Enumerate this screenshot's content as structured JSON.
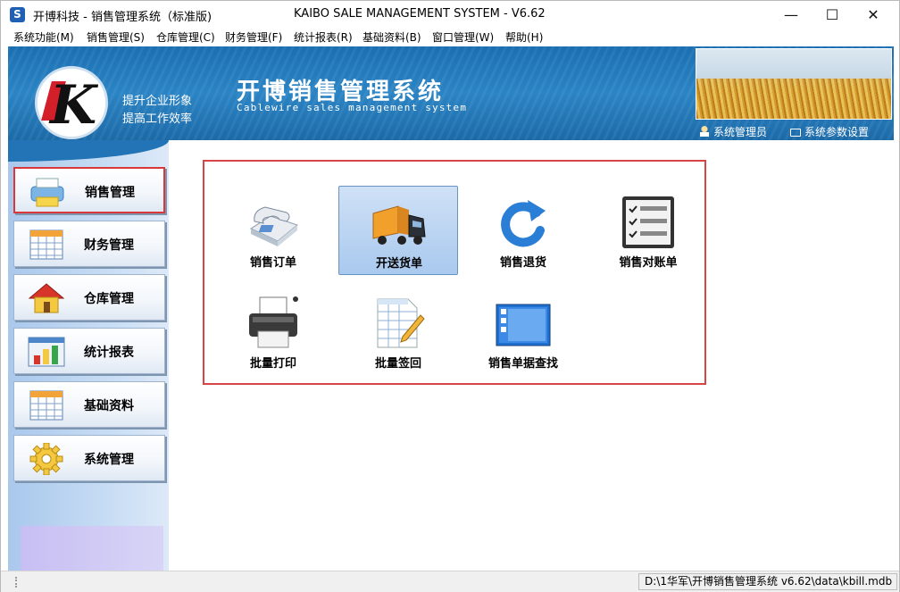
{
  "titlebar": {
    "title_left": "开博科技 - 销售管理系统（标准版)",
    "title_center": "KAIBO SALE MANAGEMENT SYSTEM - V6.62",
    "minimize": "—",
    "maximize": "☐",
    "close": "✕"
  },
  "menu": {
    "items": [
      {
        "label": "系统功能(M)"
      },
      {
        "label": "销售管理(S)"
      },
      {
        "label": "仓库管理(C)"
      },
      {
        "label": "财务管理(F)"
      },
      {
        "label": "统计报表(R)"
      },
      {
        "label": "基础资料(B)"
      },
      {
        "label": "窗口管理(W)"
      },
      {
        "label": "帮助(H)"
      }
    ]
  },
  "banner": {
    "slogan_1": "提升企业形象",
    "slogan_2": "提高工作效率",
    "system_title": "开博销售管理系统",
    "system_subtitle": "Cablewire sales management system",
    "user_label": "系统管理员",
    "settings_label": "系统参数设置"
  },
  "sidebar": {
    "items": [
      {
        "label": "销售管理",
        "icon": "printer-icon"
      },
      {
        "label": "财务管理",
        "icon": "calendar-icon"
      },
      {
        "label": "仓库管理",
        "icon": "house-icon"
      },
      {
        "label": "统计报表",
        "icon": "bar-chart-icon"
      },
      {
        "label": "基础资料",
        "icon": "calendar-icon"
      },
      {
        "label": "系统管理",
        "icon": "gear-icon"
      }
    ]
  },
  "functions": {
    "items": [
      {
        "label": "销售订单",
        "icon": "telephone-icon"
      },
      {
        "label": "开送货单",
        "icon": "truck-icon"
      },
      {
        "label": "销售退货",
        "icon": "refresh-arrow-icon"
      },
      {
        "label": "销售对账单",
        "icon": "checklist-icon"
      },
      {
        "label": "批量打印",
        "icon": "printer-icon"
      },
      {
        "label": "批量签回",
        "icon": "spreadsheet-pencil-icon"
      },
      {
        "label": "销售单据查找",
        "icon": "window-list-icon"
      }
    ]
  },
  "status": {
    "path": "D:\\1华军\\开博销售管理系统 v6.62\\data\\kbill.mdb"
  }
}
